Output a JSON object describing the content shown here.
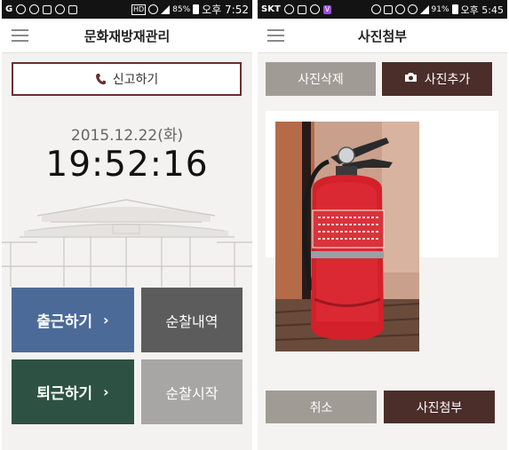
{
  "left_screen": {
    "statusbar": {
      "carrier_icons": "G",
      "hd": "HD",
      "battery": "85%",
      "clock": "오후 7:52"
    },
    "appbar": {
      "title": "문화재방재관리"
    },
    "report_button": {
      "label": "신고하기"
    },
    "date": "2015.12.22(화)",
    "time": "19:52:16",
    "tiles": {
      "checkin": "출근하기",
      "history": "순찰내역",
      "checkout": "퇴근하기",
      "start": "순찰시작"
    },
    "chevron": "›"
  },
  "right_screen": {
    "statusbar": {
      "carrier": "SKT",
      "v_badge": "V",
      "battery": "91%",
      "clock": "오후 5:45"
    },
    "appbar": {
      "title": "사진첨부"
    },
    "buttons": {
      "delete": "사진삭제",
      "add": "사진추가",
      "cancel": "취소",
      "attach": "사진첨부"
    }
  },
  "icons": [
    "menu-icon",
    "phone-icon",
    "camera-icon",
    "fire-extinguisher-photo"
  ],
  "colors": {
    "checkin": "#4b6a98",
    "checkout": "#2d5244",
    "history": "#5c5c5c",
    "start": "#a8a6a4",
    "brand_dark": "#4b2e2a",
    "muted": "#a09b95"
  }
}
